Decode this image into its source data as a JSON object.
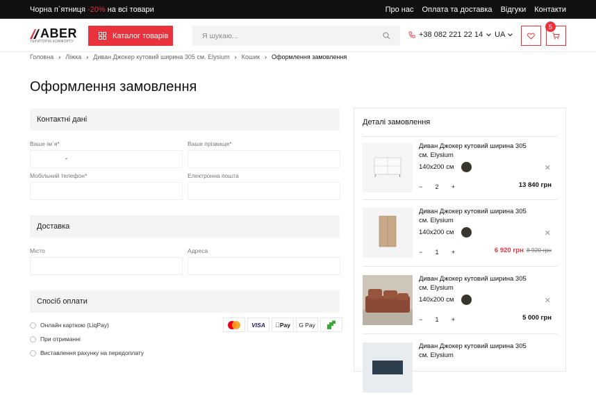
{
  "topbar": {
    "promo_text": "Чорна п`ятниця ",
    "promo_pct": "-20%",
    "promo_tail": " на всі товари",
    "links": [
      "Про нас",
      "Оплата та доставка",
      "Відгуки",
      "Контакти"
    ]
  },
  "header": {
    "brand": "ABER",
    "tagline": "ТЕРИТОРІЯ КОМФОРТУ",
    "catalog_label": "Каталог товарів",
    "search_placeholder": "Я шукаю...",
    "phone": "+38 082 221 22 14",
    "lang": "UA",
    "cart_count": "5"
  },
  "breadcrumbs": [
    "Головна",
    "Ліжка",
    "Диван Джокер кутовий ширина 305 см. Elysium",
    "Кошик",
    "Оформлення замовлення"
  ],
  "page_title": "Оформлення замовлення",
  "contact": {
    "title": "Контактні дані",
    "first_name_label": "Ваше ім`я*",
    "first_name_value": "-",
    "last_name_label": "Ваше прізвище*",
    "phone_label": "Мобільний телефон*",
    "email_label": "Електронна пошта"
  },
  "delivery": {
    "title": "Доставка",
    "city_label": "Місто",
    "address_label": "Адреса"
  },
  "payment": {
    "title": "Спосіб оплати",
    "options": [
      "Онлайн карткою (LiqPay)",
      "При отриманні",
      "Виставлення рахунку на передоплату"
    ],
    "logos": [
      "mastercard",
      "VISA",
      "Pay",
      "G Pay",
      "privat"
    ]
  },
  "order": {
    "title": "Деталі замовлення",
    "items": [
      {
        "name": "Диван Джокер кутовий ширина 305 см. Elysium",
        "size": "140х200 см",
        "qty": "2",
        "price": "13 840 грн",
        "old_price": ""
      },
      {
        "name": "Диван Джокер кутовий ширина 305 см. Elysium",
        "size": "140х200 см",
        "qty": "1",
        "price": "6 920 грн",
        "old_price": "8 920 грн"
      },
      {
        "name": "Диван Джокер кутовий ширина 305 см. Elysium",
        "size": "140х200 см",
        "qty": "1",
        "price": "5 000 грн",
        "old_price": ""
      },
      {
        "name": "Диван Джокер кутовий ширина 305 см. Elysium",
        "size": "",
        "qty": "",
        "price": "",
        "old_price": ""
      }
    ]
  },
  "colors": {
    "accent": "#e8333c",
    "dark": "#111111",
    "swatch": "#3b3530"
  }
}
